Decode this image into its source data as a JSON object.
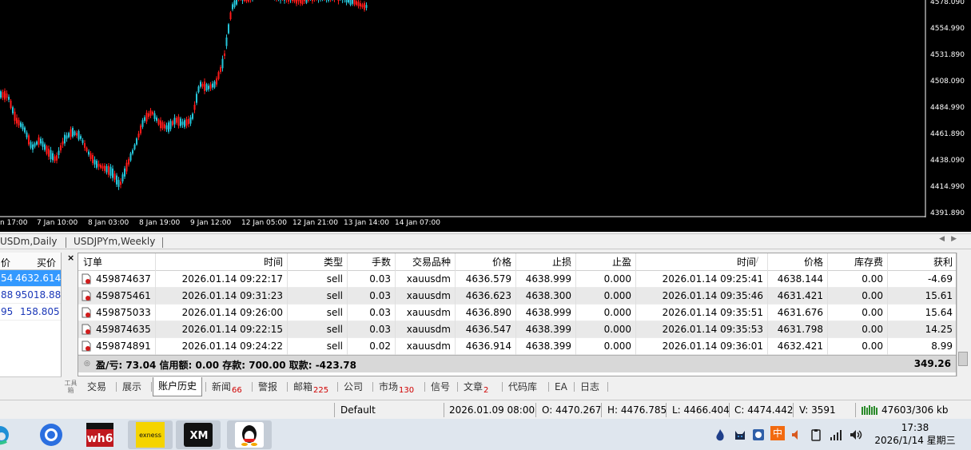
{
  "chart": {
    "price_labels": [
      "4578.090",
      "4554.990",
      "4531.890",
      "4508.090",
      "4484.990",
      "4461.890",
      "4438.090",
      "4414.990",
      "4391.890"
    ],
    "time_labels": [
      "n 17:00",
      "7 Jan 10:00",
      "8 Jan 03:00",
      "8 Jan 19:00",
      "9 Jan 12:00",
      "12 Jan 05:00",
      "12 Jan 21:00",
      "13 Jan 14:00",
      "14 Jan 07:00"
    ],
    "colors": {
      "background": "#000000",
      "bull": "#26c6da",
      "bear": "#ff1a1a"
    }
  },
  "chart_tabs": [
    "USDm,Daily",
    "USDJPYm,Weekly"
  ],
  "market_watch": {
    "headers": {
      "bid": "价",
      "ask": "买价"
    },
    "rows": [
      {
        "bid": "54",
        "ask": "4632.614",
        "selected": true
      },
      {
        "bid": "88",
        "ask": "95018.88",
        "selected": false
      },
      {
        "bid": "95",
        "ask": "158.805",
        "selected": false
      }
    ]
  },
  "terminal": {
    "close_label": "×",
    "side_label": "工具箱",
    "columns": [
      "订单",
      "时间",
      "类型",
      "手数",
      "交易品种",
      "价格",
      "止损",
      "止盈",
      "时间",
      "价格",
      "库存费",
      "获利"
    ],
    "sort_indicator": "/",
    "rows": [
      [
        "459874637",
        "2026.01.14 09:22:17",
        "sell",
        "0.03",
        "xauusdm",
        "4636.579",
        "4638.999",
        "0.000",
        "2026.01.14 09:25:41",
        "4638.144",
        "0.00",
        "-4.69"
      ],
      [
        "459875461",
        "2026.01.14 09:31:23",
        "sell",
        "0.03",
        "xauusdm",
        "4636.623",
        "4638.300",
        "0.000",
        "2026.01.14 09:35:46",
        "4631.421",
        "0.00",
        "15.61"
      ],
      [
        "459875033",
        "2026.01.14 09:26:00",
        "sell",
        "0.03",
        "xauusdm",
        "4636.890",
        "4638.999",
        "0.000",
        "2026.01.14 09:35:51",
        "4631.676",
        "0.00",
        "15.64"
      ],
      [
        "459874635",
        "2026.01.14 09:22:15",
        "sell",
        "0.03",
        "xauusdm",
        "4636.547",
        "4638.399",
        "0.000",
        "2026.01.14 09:35:53",
        "4631.798",
        "0.00",
        "14.25"
      ],
      [
        "459874891",
        "2026.01.14 09:24:22",
        "sell",
        "0.02",
        "xauusdm",
        "4636.914",
        "4638.399",
        "0.000",
        "2026.01.14 09:36:01",
        "4632.421",
        "0.00",
        "8.99"
      ]
    ],
    "summary": {
      "text": "盈/亏: 73.04  信用额: 0.00  存款: 700.00  取款: -423.78",
      "total": "349.26"
    },
    "tabs": [
      {
        "label": "交易",
        "badge": ""
      },
      {
        "label": "展示",
        "badge": ""
      },
      {
        "label": "账户历史",
        "badge": "",
        "active": true
      },
      {
        "label": "新闻",
        "badge": "66"
      },
      {
        "label": "警报",
        "badge": ""
      },
      {
        "label": "邮箱",
        "badge": "225"
      },
      {
        "label": "公司",
        "badge": ""
      },
      {
        "label": "市场",
        "badge": "130"
      },
      {
        "label": "信号",
        "badge": ""
      },
      {
        "label": "文章",
        "badge": "2"
      },
      {
        "label": "代码库",
        "badge": ""
      },
      {
        "label": "EA",
        "badge": ""
      },
      {
        "label": "日志",
        "badge": ""
      }
    ]
  },
  "status_bar": {
    "profile": "Default",
    "datetime": "2026.01.09 08:00",
    "open": "O: 4470.267",
    "high": "H: 4476.785",
    "low": "L: 4466.404",
    "close": "C: 4474.442",
    "volume": "V: 3591",
    "traffic": "47603/306 kb"
  },
  "taskbar": {
    "apps": [
      "edge-icon",
      "browser-icon",
      "wh6-icon",
      "exness-icon",
      "xm-icon",
      "qq-icon"
    ],
    "app_labels": {
      "wh6": "wh6",
      "exness": "exness",
      "xm": "XM"
    },
    "tray_ime": "中",
    "time": "17:38",
    "date": "2026/1/14 星期三"
  }
}
